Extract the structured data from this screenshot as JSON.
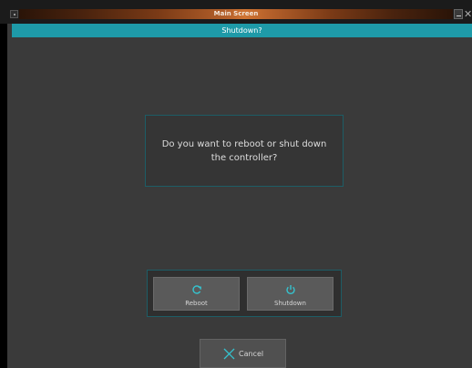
{
  "window": {
    "title": "Main Screen"
  },
  "dialog": {
    "header": "Shutdown?",
    "message": "Do you want to reboot or shut down the controller?"
  },
  "actions": {
    "reboot": {
      "label": "Reboot",
      "icon": "refresh-icon"
    },
    "shutdown": {
      "label": "Shutdown",
      "icon": "power-icon"
    },
    "cancel": {
      "label": "Cancel",
      "icon": "x-icon"
    }
  },
  "colors": {
    "accent": "#1e9aa8",
    "icon_accent": "#35c3cf",
    "background": "#3a3a3a",
    "button": "#5a5a5a",
    "title_gradient_center": "#d07432"
  }
}
